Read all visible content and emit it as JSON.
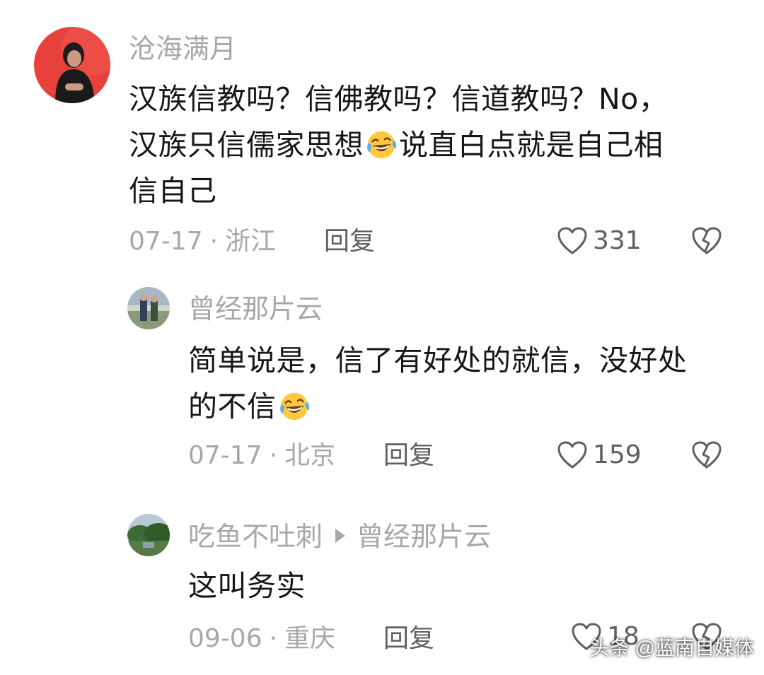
{
  "comments": [
    {
      "username": "沧海满月",
      "text_lines": [
        "汉族信教吗？信佛教吗？信道教吗？No，",
        "汉族只信儒家思想",
        "说直白点就是自己相",
        "信自己"
      ],
      "date": "07-17",
      "location": "浙江",
      "reply_label": "回复",
      "likes": "331"
    },
    {
      "username": "曾经那片云",
      "text_lines": [
        "简单说是，信了有好处的就信，没好处",
        "的不信"
      ],
      "date": "07-17",
      "location": "北京",
      "reply_label": "回复",
      "likes": "159"
    },
    {
      "username": "吃鱼不吐刺",
      "reply_to": "曾经那片云",
      "text_lines": [
        "这叫务实"
      ],
      "date": "09-06",
      "location": "重庆",
      "reply_label": "回复",
      "likes": "18"
    }
  ],
  "meta_separator": "·",
  "watermark": "头条 @蓝南自媒体",
  "colors": {
    "username": "#a7a7a7",
    "text": "#161616",
    "meta": "#a7a7a7",
    "action": "#5f5f5f",
    "avatar1_bg": "#e8403a"
  },
  "icons": {
    "like": "heart-outline-icon",
    "dislike": "broken-heart-icon",
    "emoji": "rolling-laugh-emoji",
    "reply_arrow": "triangle-right-icon"
  }
}
